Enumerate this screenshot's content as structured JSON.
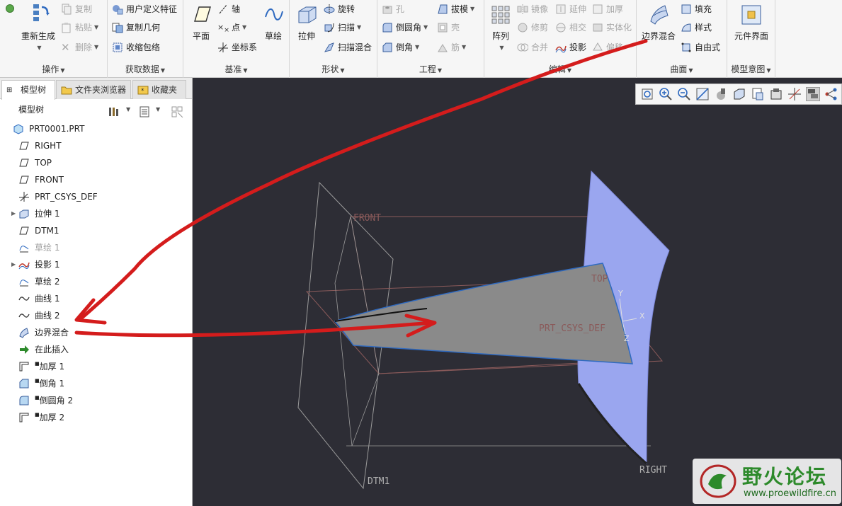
{
  "ribbon": {
    "operations": {
      "group_label": "操作",
      "regenerate": "重新生成",
      "copy": "复制",
      "paste": "粘贴",
      "delete": "删除"
    },
    "get_data": {
      "group_label": "获取数据",
      "udf": "用户定义特征",
      "copy_geom": "复制几何",
      "shrinkwrap": "收缩包络"
    },
    "datum": {
      "group_label": "基准",
      "plane": "平面",
      "axis": "轴",
      "point": "点",
      "csys": "坐标系",
      "sketch": "草绘"
    },
    "shapes": {
      "group_label": "形状",
      "extrude": "拉伸",
      "revolve": "旋转",
      "sweep": "扫描",
      "swept_blend": "扫描混合"
    },
    "engineering": {
      "group_label": "工程",
      "hole": "孔",
      "round": "倒圆角",
      "chamfer": "倒角",
      "draft": "拔模",
      "shell": "壳",
      "rib": "筋"
    },
    "editing": {
      "group_label": "编辑",
      "pattern": "阵列",
      "mirror": "镜像",
      "trim": "修剪",
      "merge": "合并",
      "extend": "延伸",
      "intersect": "相交",
      "project": "投影",
      "thicken": "加厚",
      "solidify": "实体化",
      "offset": "偏移"
    },
    "surfaces": {
      "group_label": "曲面",
      "boundary_blend": "边界混合",
      "fill": "填充",
      "style": "样式",
      "freestyle": "自由式"
    },
    "model_intent": {
      "group_label": "模型意图",
      "component_interface": "元件界面"
    }
  },
  "left_panel": {
    "tabs": [
      "模型树",
      "文件夹浏览器",
      "收藏夹"
    ],
    "tree_title": "模型树",
    "items": [
      {
        "label": "PRT0001.PRT",
        "icon": "part-icon"
      },
      {
        "label": "RIGHT",
        "icon": "datum-plane-icon"
      },
      {
        "label": "TOP",
        "icon": "datum-plane-icon"
      },
      {
        "label": "FRONT",
        "icon": "datum-plane-icon"
      },
      {
        "label": "PRT_CSYS_DEF",
        "icon": "csys-icon"
      },
      {
        "label": "拉伸 1",
        "icon": "extrude-icon"
      },
      {
        "label": "DTM1",
        "icon": "datum-plane-icon"
      },
      {
        "label": "草绘 1",
        "icon": "sketch-icon"
      },
      {
        "label": "投影 1",
        "icon": "project-icon"
      },
      {
        "label": "草绘 2",
        "icon": "sketch-icon"
      },
      {
        "label": "曲线 1",
        "icon": "curve-icon"
      },
      {
        "label": "曲线 2",
        "icon": "curve-icon"
      },
      {
        "label": "边界混合",
        "icon": "boundary-blend-icon"
      },
      {
        "label": "在此插入",
        "icon": "insert-here-icon"
      },
      {
        "label": "加厚 1",
        "icon": "thicken-icon",
        "prefix": "■"
      },
      {
        "label": "倒角 1",
        "icon": "chamfer-icon",
        "prefix": "■"
      },
      {
        "label": "倒圆角 2",
        "icon": "round-icon",
        "prefix": "■"
      },
      {
        "label": "加厚 2",
        "icon": "thicken-icon",
        "prefix": "■"
      }
    ]
  },
  "viewport": {
    "labels": {
      "front": "FRONT",
      "top": "TOP",
      "right": "RIGHT",
      "dtm1": "DTM1",
      "csys": "PRT_CSYS_DEF",
      "x": "X",
      "y": "Y",
      "z": "Z"
    },
    "colors": {
      "background": "#2d2d35",
      "datum_plane_front": "#8a5a5a",
      "datum_plane_other": "#9a9a9a",
      "surface_blue": "#9aa6ef",
      "surface_gray": "#8a8a8a",
      "annotation_red": "#d41c1c"
    }
  },
  "watermark": {
    "name": "野火论坛",
    "url": "www.proewildfire.cn"
  }
}
